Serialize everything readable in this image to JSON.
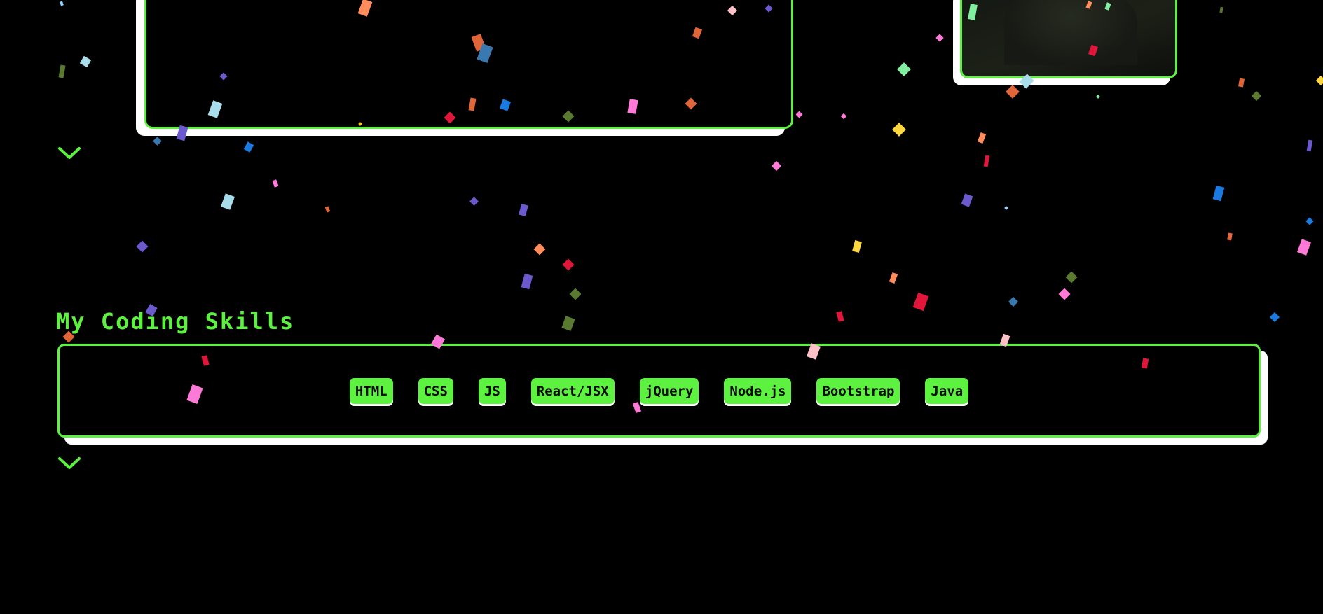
{
  "section": {
    "title": "My Coding Skills"
  },
  "skills": [
    "HTML",
    "CSS",
    "JS",
    "React/JSX",
    "jQuery",
    "Node.js",
    "Bootstrap",
    "Java"
  ],
  "colors": {
    "background": "#000000",
    "accent": "#5cf23f",
    "shadow": "#ffffff",
    "badge_text": "#0a0a0a"
  },
  "icons": {
    "expand": "chevron-down-icon"
  }
}
